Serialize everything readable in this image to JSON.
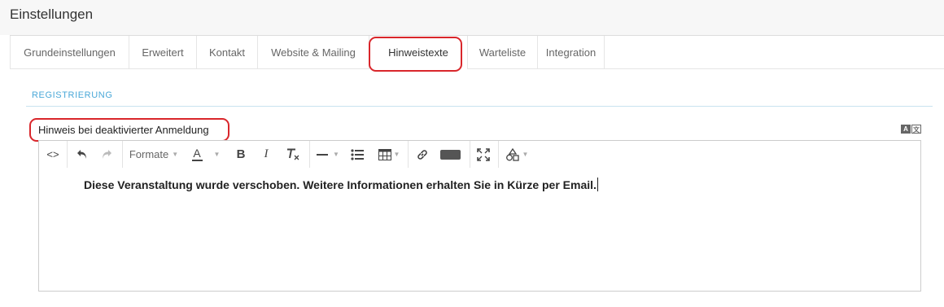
{
  "header": {
    "title": "Einstellungen"
  },
  "tabs": [
    {
      "label": "Grundeinstellungen"
    },
    {
      "label": "Erweitert"
    },
    {
      "label": "Kontakt"
    },
    {
      "label": "Website & Mailing"
    },
    {
      "label": "Hinweistexte",
      "active": true
    },
    {
      "label": "Warteliste"
    },
    {
      "label": "Integration"
    }
  ],
  "section": {
    "title": "REGISTRIERUNG"
  },
  "field": {
    "label": "Hinweis bei deaktivierter Anmeldung"
  },
  "translate_badge": {
    "left": "A",
    "right": "文"
  },
  "toolbar": {
    "source_label": "<>",
    "format_label": "Formate",
    "bold_label": "B",
    "italic_label": "I",
    "font_color_label": "A",
    "buttons": [
      "source-code",
      "undo",
      "redo",
      "format",
      "font-color",
      "bold",
      "italic",
      "clear-format",
      "horizontal-line",
      "bulleted-list",
      "table",
      "link",
      "placeholder-block",
      "fullscreen",
      "shapes"
    ]
  },
  "editor": {
    "content": "Diese Veranstaltung wurde verschoben. Weitere Informationen erhalten Sie in Kürze per Email."
  },
  "colors": {
    "highlight": "#d9262b",
    "section_title": "#4aa8d8",
    "topbar": "#f7f7f7"
  }
}
